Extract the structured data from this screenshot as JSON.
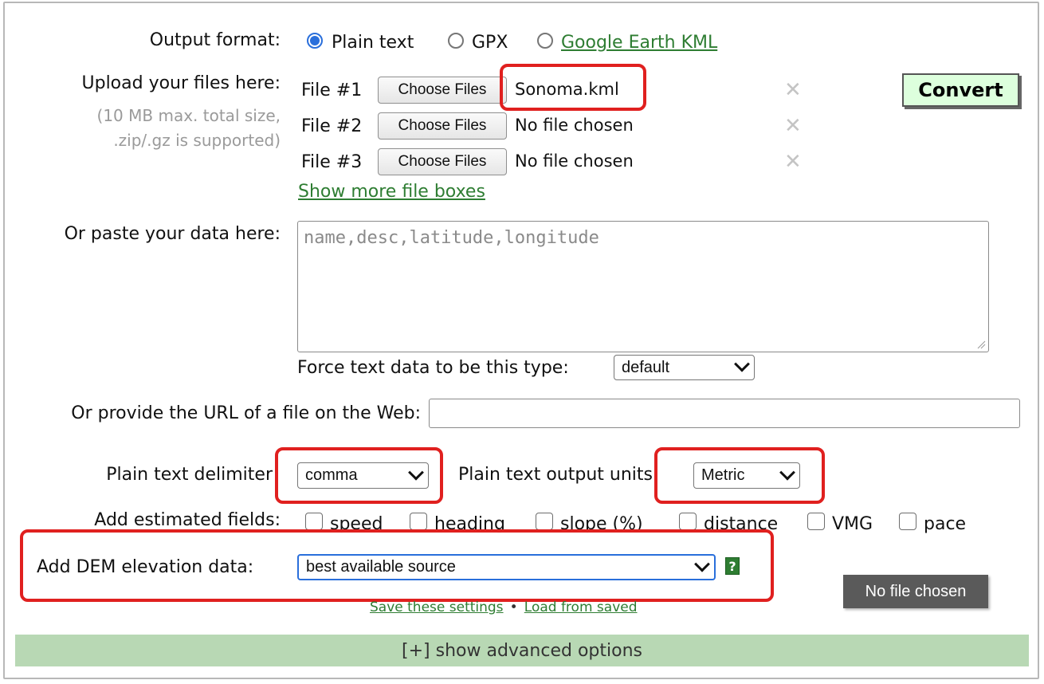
{
  "output_format": {
    "label": "Output format:",
    "options": [
      {
        "label": "Plain text",
        "selected": true
      },
      {
        "label": "GPX",
        "selected": false
      },
      {
        "label": "Google Earth KML",
        "selected": false,
        "is_link": true
      }
    ]
  },
  "upload": {
    "label": "Upload your files here:",
    "hint_line1": "(10 MB max. total size,",
    "hint_line2": ".zip/.gz is supported)",
    "files": [
      {
        "label": "File #1",
        "button": "Choose Files",
        "filename": "Sonoma.kml"
      },
      {
        "label": "File #2",
        "button": "Choose Files",
        "filename": "No file chosen"
      },
      {
        "label": "File #3",
        "button": "Choose Files",
        "filename": "No file chosen"
      }
    ],
    "remove_glyph": "✕",
    "show_more": "Show more file boxes"
  },
  "convert_button": "Convert",
  "paste": {
    "label": "Or paste your data here:",
    "placeholder": "name,desc,latitude,longitude",
    "force_type_label": "Force text data to be this type:",
    "force_type_value": "default"
  },
  "url": {
    "label": "Or provide the URL of a file on the Web:",
    "value": ""
  },
  "delimiter": {
    "label": "Plain text delimiter",
    "value": "comma"
  },
  "units": {
    "label": "Plain text output units:",
    "value": "Metric"
  },
  "estimated_fields": {
    "label": "Add estimated fields:",
    "options": [
      "speed",
      "heading",
      "slope (%)",
      "distance",
      "VMG",
      "pace"
    ]
  },
  "dem": {
    "label": "Add DEM elevation data:",
    "value": "best available source",
    "help": "?"
  },
  "tooltip": "No file chosen",
  "settings": {
    "save": "Save these settings",
    "separator": "•",
    "load": "Load from saved"
  },
  "advanced": "[+] show advanced options",
  "colors": {
    "accent": "#2a6fdb",
    "link": "#2e7d32",
    "highlight": "#e0201f",
    "advanced_bar": "#b8d8b4",
    "convert_bg": "#ddffdd"
  }
}
